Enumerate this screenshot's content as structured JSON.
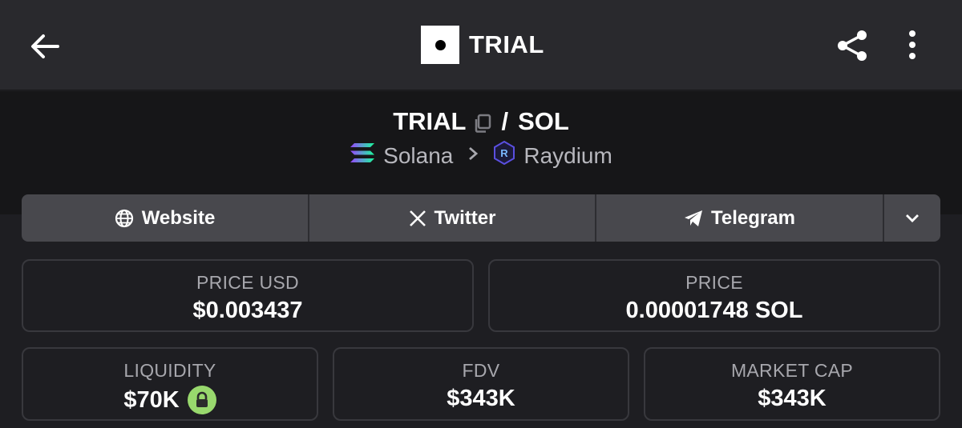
{
  "header": {
    "title": "TRIAL",
    "back_icon": "arrow-left-icon",
    "share_icon": "share-icon",
    "more_icon": "more-vertical-icon"
  },
  "pair": {
    "base": "TRIAL",
    "slash": "/",
    "quote": "SOL",
    "chain": "Solana",
    "dex": "Raydium"
  },
  "links": {
    "website": "Website",
    "twitter": "Twitter",
    "telegram": "Telegram",
    "more_icon": "chevron-down-icon"
  },
  "stats": {
    "price_usd": {
      "label": "PRICE USD",
      "value": "$0.003437"
    },
    "price": {
      "label": "PRICE",
      "value": "0.00001748 SOL"
    },
    "liquidity": {
      "label": "LIQUIDITY",
      "value": "$70K"
    },
    "fdv": {
      "label": "FDV",
      "value": "$343K"
    },
    "market_cap": {
      "label": "MARKET CAP",
      "value": "$343K"
    }
  },
  "colors": {
    "header_bg": "#29292d",
    "pair_bg": "#161618",
    "page_bg": "#1e1e22",
    "links_bg": "#48484d",
    "lock_green": "#98d86d"
  }
}
